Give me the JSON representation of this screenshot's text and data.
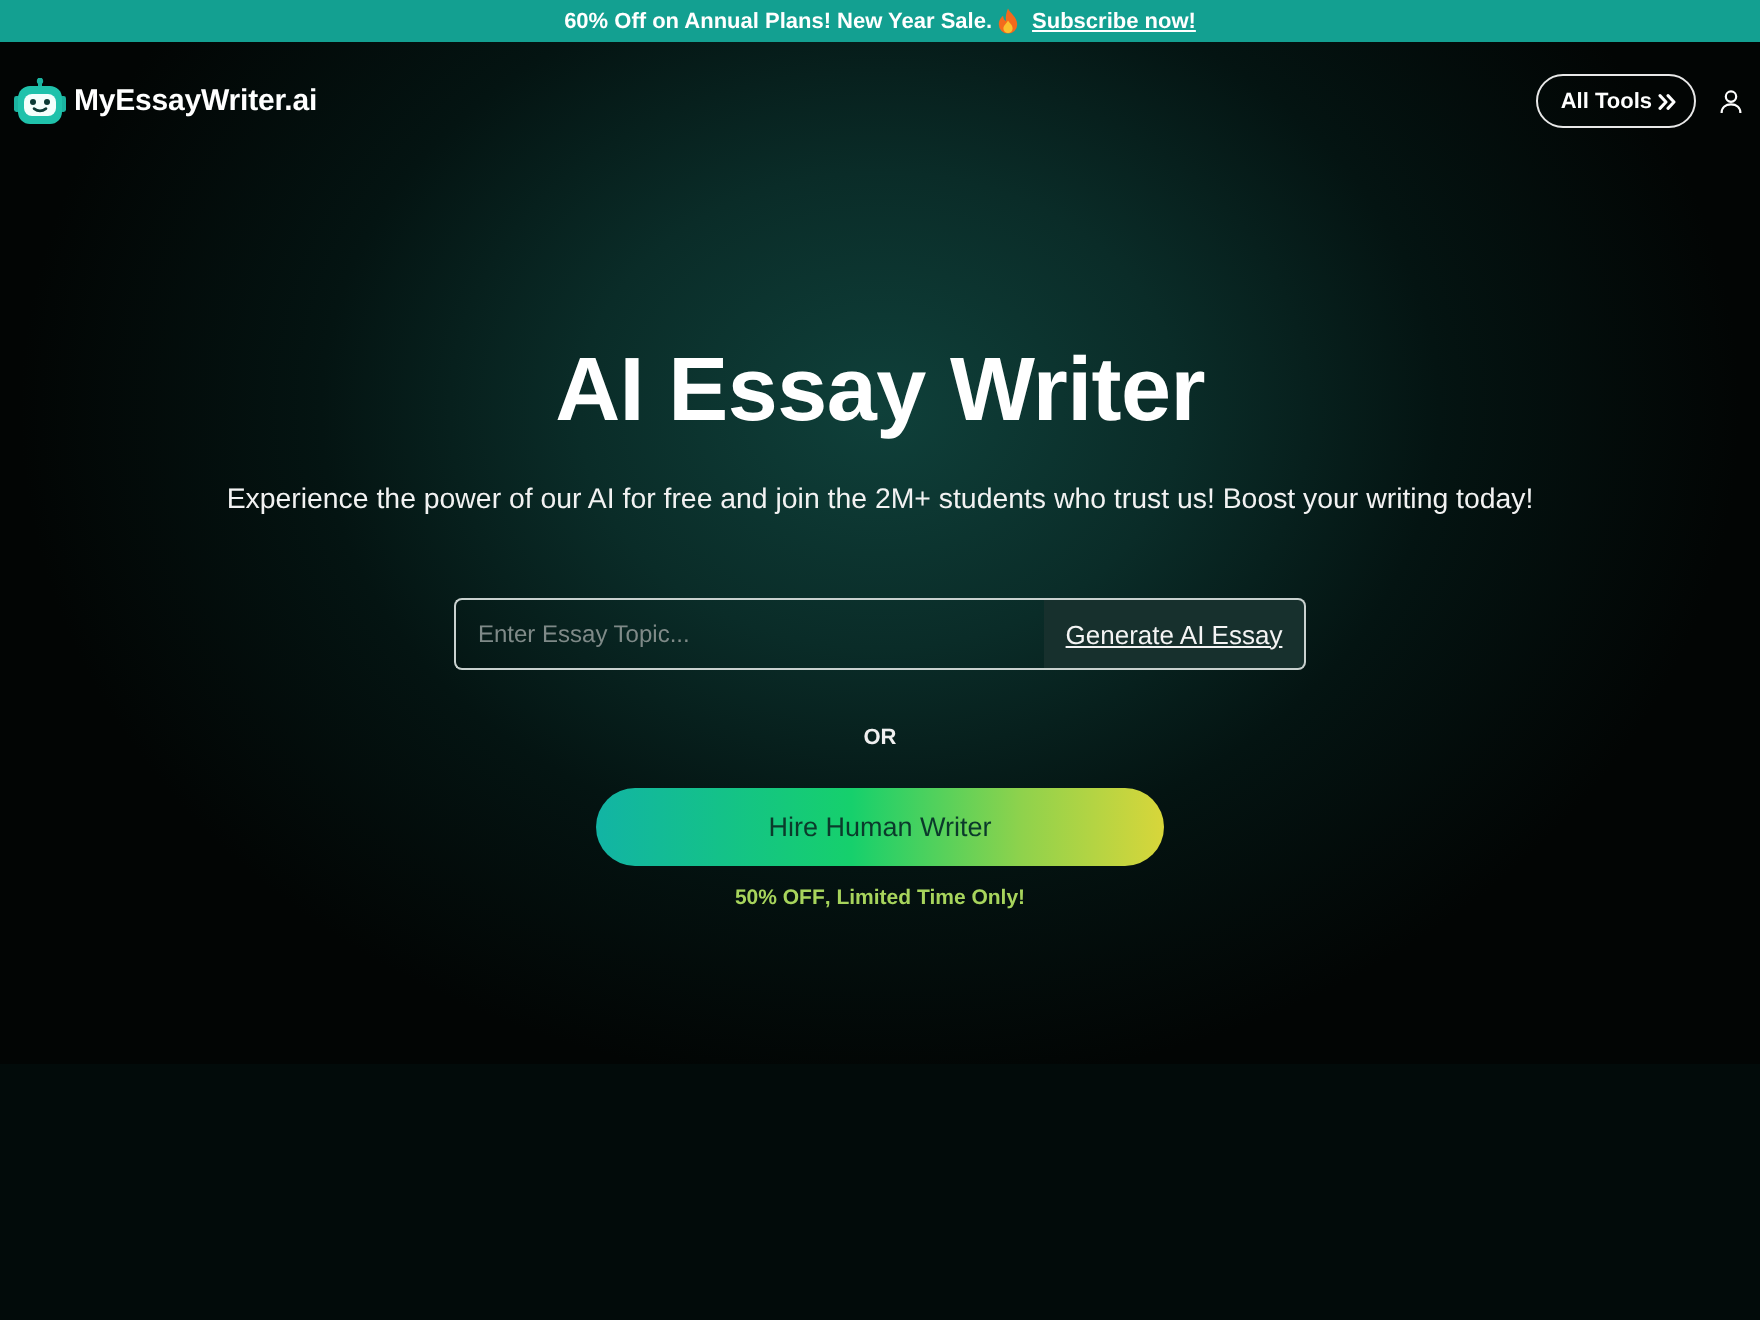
{
  "promo_banner": {
    "text": "60% Off on Annual Plans! New Year Sale.",
    "link": "Subscribe now!"
  },
  "header": {
    "logo": "MyEssayWriter.ai",
    "tools_button": "All Tools"
  },
  "hero": {
    "title": "AI Essay Writer",
    "subtitle": "Experience the power of our AI for free and join the 2M+ students who trust us! Boost your writing today!",
    "topic_field": {
      "placeholder": "Enter Essay Topic..."
    },
    "generate_button": "Generate AI Essay",
    "divider": "OR",
    "hire_button": "Hire Human Writer",
    "offer": "**50% OFF**, Limited Time Only!"
  }
}
